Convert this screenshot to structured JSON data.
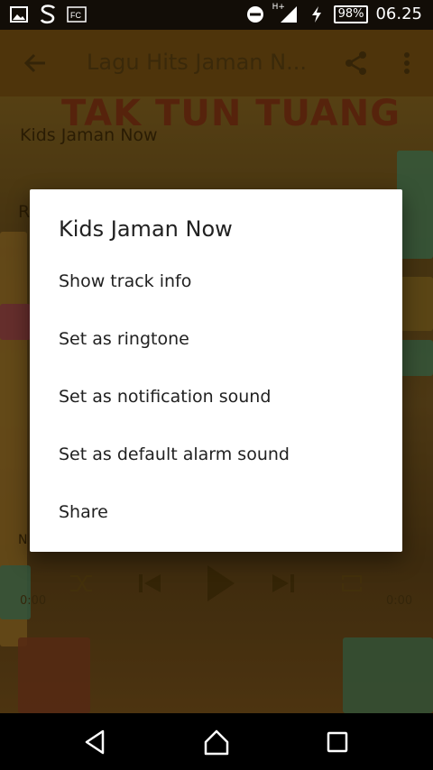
{
  "status_bar": {
    "battery": "98%",
    "time": "06.25",
    "network": "H+",
    "icons": [
      "image-icon",
      "s-app-icon",
      "fc-app-icon",
      "dnd-icon",
      "signal-icon",
      "charging-icon",
      "battery-icon"
    ],
    "fc_label": "FC"
  },
  "appbar": {
    "title": "Lagu Hits Jaman N...",
    "icons": [
      "back-arrow-icon",
      "share-icon",
      "more-vert-icon"
    ]
  },
  "background": {
    "cover_text": "TAK TUN TUANG",
    "track_label": "Kids Jaman Now",
    "partial_r": "R",
    "partial_n": "N",
    "time_elapsed": "0:00",
    "time_total": "0:00",
    "controls": [
      "shuffle-icon",
      "previous-icon",
      "play-icon",
      "next-icon",
      "repeat-icon"
    ]
  },
  "dialog": {
    "title": "Kids Jaman Now",
    "items": [
      {
        "label": "Show track info"
      },
      {
        "label": "Set as ringtone"
      },
      {
        "label": "Set as notification sound"
      },
      {
        "label": "Set as default alarm sound"
      },
      {
        "label": "Share"
      }
    ]
  },
  "navbar": {
    "icons": [
      "back-triangle-icon",
      "home-icon",
      "recents-icon"
    ]
  },
  "colors": {
    "appbar": "#5d3f12",
    "dialog_bg": "#ffffff",
    "text_primary": "#212121"
  }
}
